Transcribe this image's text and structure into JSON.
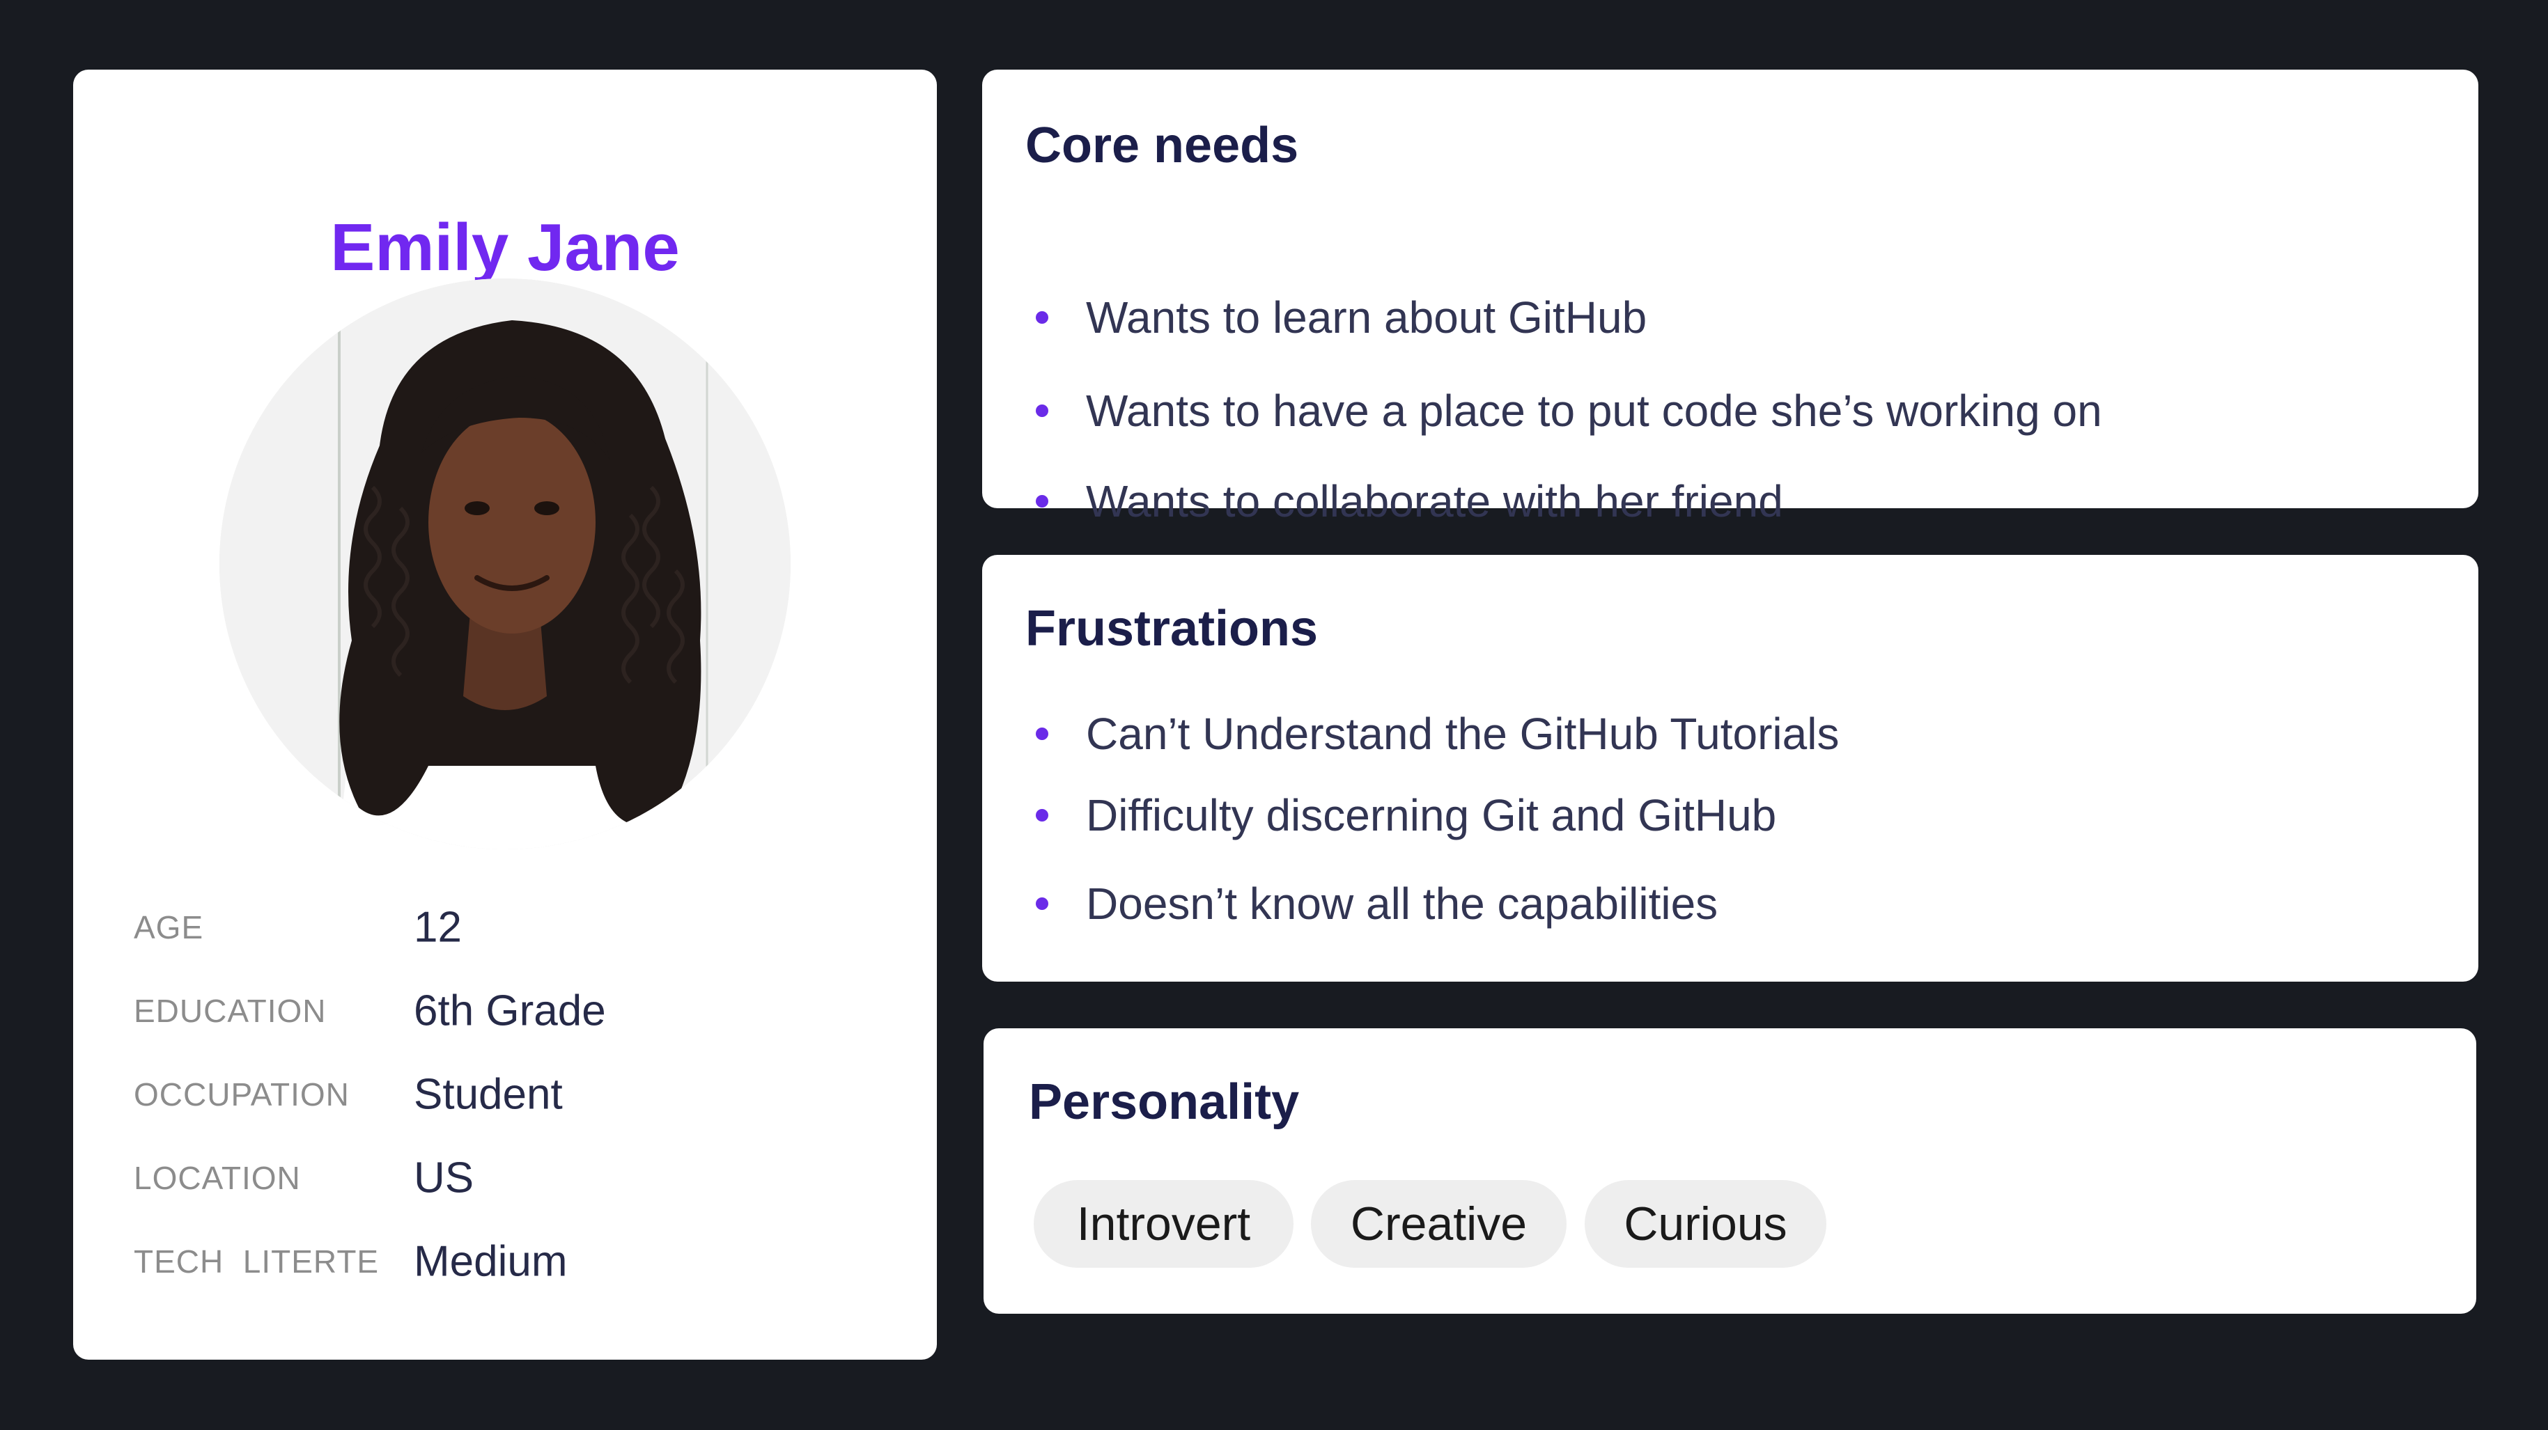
{
  "profile": {
    "name": "Emily Jane",
    "attributes": [
      {
        "label": "AGE",
        "value": "12"
      },
      {
        "label": "EDUCATION",
        "value": "6th Grade"
      },
      {
        "label": "OCCUPATION",
        "value": "Student"
      },
      {
        "label": "LOCATION",
        "value": "US"
      },
      {
        "label": "TECH  LITERTE",
        "value": "Medium"
      }
    ]
  },
  "core_needs": {
    "title": "Core needs",
    "items": [
      "Wants to learn about GitHub",
      "Wants to have a place to put code she’s working on",
      "Wants to collaborate with her friend"
    ]
  },
  "frustrations": {
    "title": "Frustrations",
    "items": [
      "Can’t Understand the GitHub Tutorials",
      "Difficulty discerning Git and GitHub",
      "Doesn’t know all the capabilities"
    ]
  },
  "personality": {
    "title": "Personality",
    "tags": [
      "Introvert",
      "Creative",
      "Curious"
    ]
  },
  "colors": {
    "background": "#181b21",
    "accent": "#7128f0",
    "heading": "#1b1e4a",
    "tag_background": "#eeeeee"
  }
}
